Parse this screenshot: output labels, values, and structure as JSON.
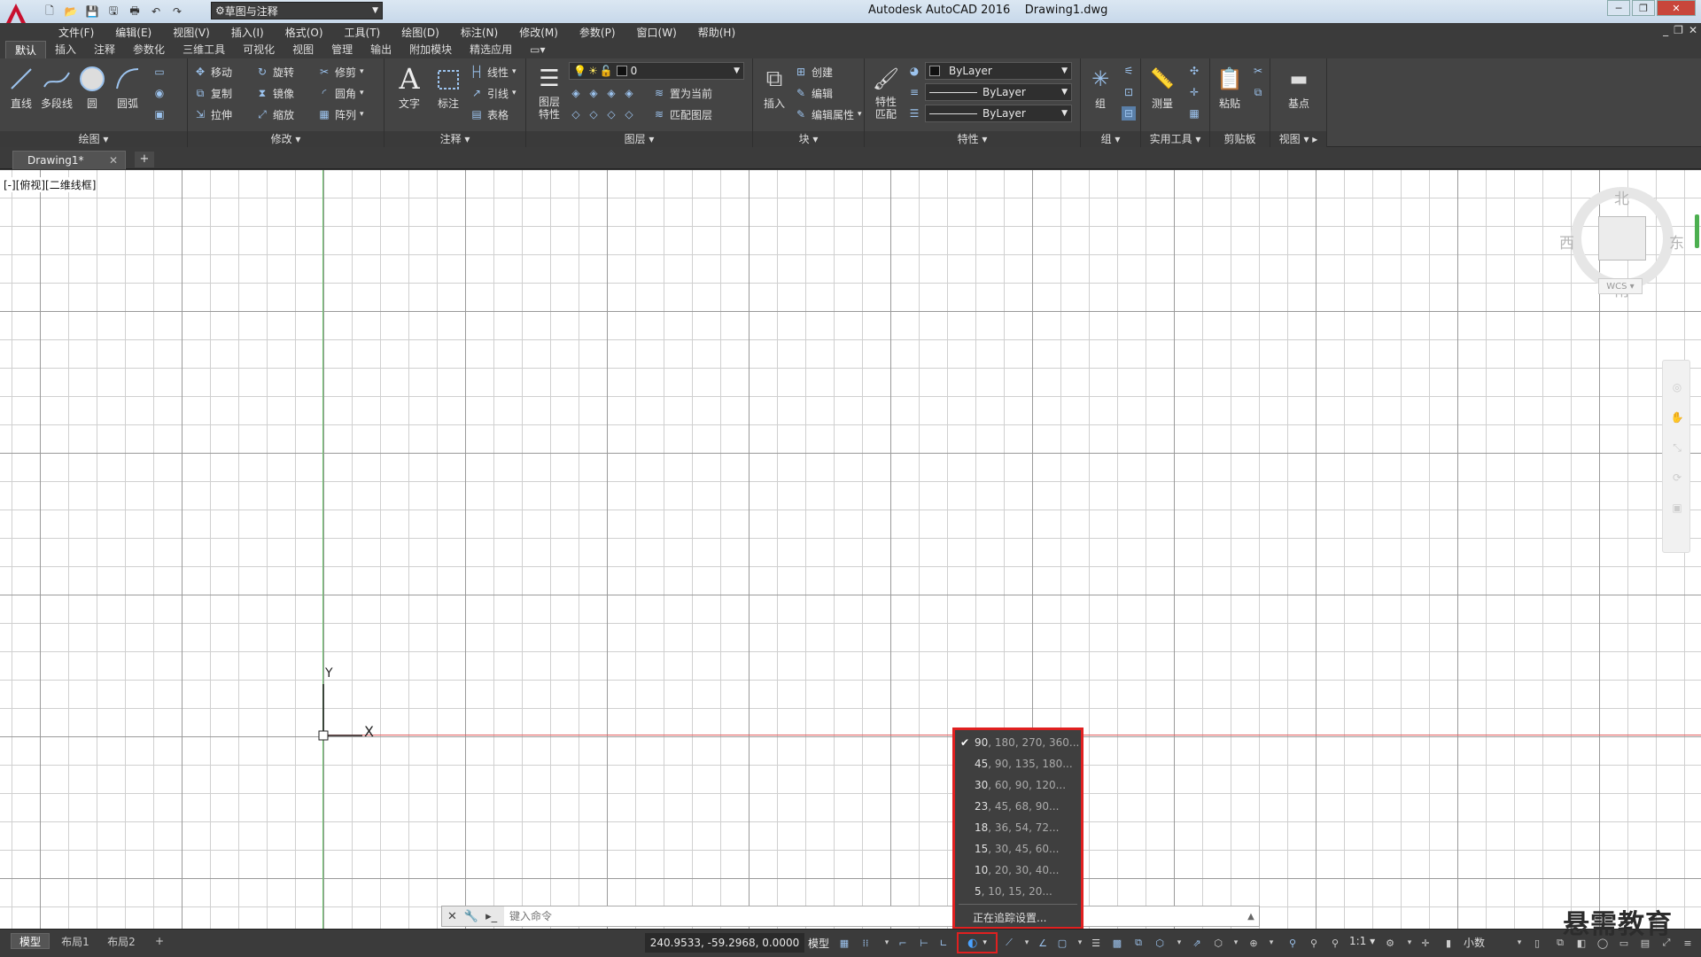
{
  "app": {
    "title": "Autodesk AutoCAD 2016",
    "document": "Drawing1.dwg",
    "workspace": "草图与注释"
  },
  "menu": [
    "文件(F)",
    "编辑(E)",
    "视图(V)",
    "插入(I)",
    "格式(O)",
    "工具(T)",
    "绘图(D)",
    "标注(N)",
    "修改(M)",
    "参数(P)",
    "窗口(W)",
    "帮助(H)"
  ],
  "ribbon_tabs": [
    "默认",
    "插入",
    "注释",
    "参数化",
    "三维工具",
    "可视化",
    "视图",
    "管理",
    "输出",
    "附加模块",
    "精选应用"
  ],
  "ribbon": {
    "draw": {
      "title": "绘图",
      "line": "直线",
      "polyline": "多段线",
      "circle": "圆",
      "arc": "圆弧"
    },
    "modify": {
      "title": "修改",
      "move": "移动",
      "rotate": "旋转",
      "trim": "修剪",
      "copy": "复制",
      "mirror": "镜像",
      "fillet": "圆角",
      "stretch": "拉伸",
      "scale": "缩放",
      "array": "阵列"
    },
    "annotation": {
      "title": "注释",
      "text": "文字",
      "dimension": "标注",
      "linear": "线性",
      "leader": "引线",
      "table": "表格"
    },
    "layers": {
      "title": "图层",
      "properties": "图层\n特性",
      "current_layer": "0",
      "set_current": "置为当前",
      "match_layer": "匹配图层"
    },
    "block": {
      "title": "块",
      "insert": "插入",
      "create": "创建",
      "edit": "编辑",
      "edit_attr": "编辑属性"
    },
    "properties": {
      "title": "特性",
      "match": "特性\n匹配",
      "color": "ByLayer",
      "linetype": "ByLayer",
      "lineweight": "ByLayer"
    },
    "groups": {
      "title": "组",
      "group": "组"
    },
    "utilities": {
      "title": "实用工具",
      "measure": "测量"
    },
    "clipboard": {
      "title": "剪贴板",
      "paste": "粘贴"
    },
    "view": {
      "title": "视图",
      "basepoint": "基点"
    }
  },
  "doc_tab": "Drawing1*",
  "viewport_label": "[-][俯视][二维线框]",
  "viewcube": {
    "north": "北",
    "south": "南",
    "east": "东",
    "west": "西",
    "wcs": "WCS"
  },
  "ucs": {
    "x": "X",
    "y": "Y"
  },
  "command": {
    "placeholder": "键入命令"
  },
  "polar_menu": {
    "items": [
      {
        "main": "90",
        "rest": ", 180, 270, 360...",
        "checked": true
      },
      {
        "main": "45",
        "rest": ", 90, 135, 180...",
        "checked": false
      },
      {
        "main": "30",
        "rest": ", 60, 90, 120...",
        "checked": false
      },
      {
        "main": "23",
        "rest": ", 45, 68, 90...",
        "checked": false
      },
      {
        "main": "18",
        "rest": ", 36, 54, 72...",
        "checked": false
      },
      {
        "main": "15",
        "rest": ", 30, 45, 60...",
        "checked": false
      },
      {
        "main": "10",
        "rest": ", 20, 30, 40...",
        "checked": false
      },
      {
        "main": "5",
        "rest": ", 10, 15, 20...",
        "checked": false
      }
    ],
    "settings": "正在追踪设置..."
  },
  "status": {
    "layout_tabs": [
      "模型",
      "布局1",
      "布局2"
    ],
    "coords": "240.9533, -59.2968, 0.0000",
    "model": "模型",
    "scale": "1:1",
    "units": "小数"
  },
  "watermark": "悬需教育",
  "colors": {
    "accent_red": "#e02020",
    "y_axis": "#6bc56b",
    "x_axis": "#e26060"
  }
}
